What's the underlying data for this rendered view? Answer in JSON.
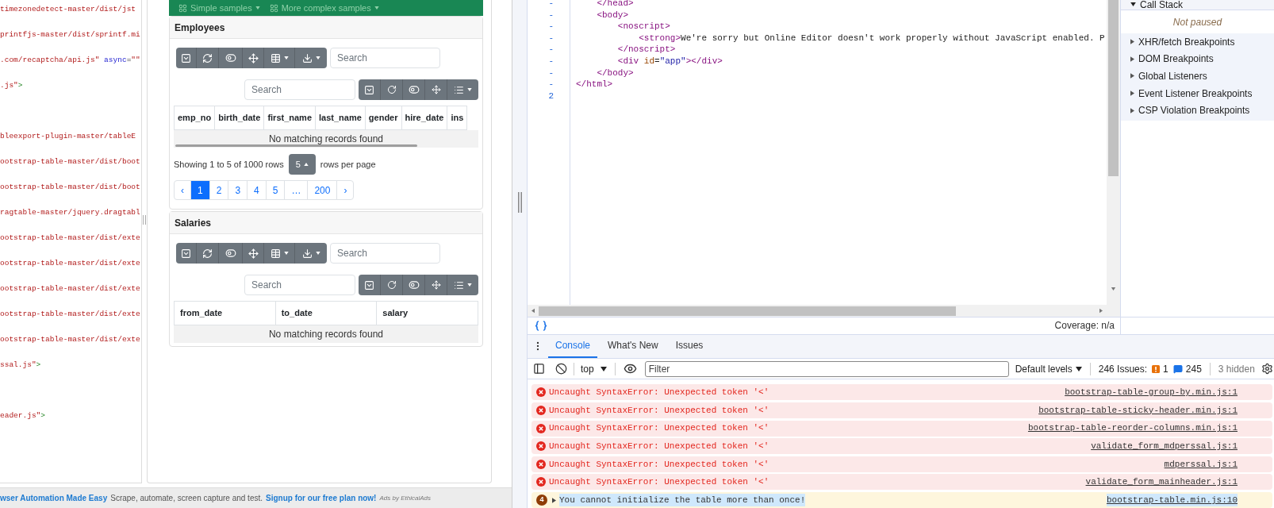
{
  "page": {
    "source_lines": [
      {
        "kind": "code",
        "parts": [
          {
            "kind": "string",
            "text": "timezonedetect-master/dist/jst"
          }
        ]
      },
      {
        "kind": "code",
        "parts": [
          {
            "kind": "string",
            "text": "printfjs-master/dist/sprintf.mi"
          }
        ]
      },
      {
        "kind": "code",
        "parts": [
          {
            "kind": "string",
            "text": ".com/recaptcha/api.js\""
          },
          {
            "kind": "attr",
            "text": " async"
          },
          {
            "kind": "punct",
            "text": "="
          },
          {
            "kind": "string",
            "text": "\"\""
          }
        ]
      },
      {
        "kind": "code",
        "parts": [
          {
            "kind": "string",
            "text": ".js\""
          },
          {
            "kind": "bracket",
            "text": ">"
          }
        ]
      },
      {
        "kind": "blank"
      },
      {
        "kind": "code",
        "parts": [
          {
            "kind": "string",
            "text": "bleexport-plugin-master/tableE"
          }
        ]
      },
      {
        "kind": "code",
        "parts": [
          {
            "kind": "string",
            "text": "ootstrap-table-master/dist/boot"
          }
        ]
      },
      {
        "kind": "code",
        "parts": [
          {
            "kind": "string",
            "text": "ootstrap-table-master/dist/boot"
          }
        ]
      },
      {
        "kind": "code",
        "parts": [
          {
            "kind": "string",
            "text": "ragtable-master/jquery.dragtabl"
          }
        ]
      },
      {
        "kind": "code",
        "parts": [
          {
            "kind": "string",
            "text": "ootstrap-table-master/dist/exte"
          }
        ]
      },
      {
        "kind": "code",
        "parts": [
          {
            "kind": "string",
            "text": "ootstrap-table-master/dist/exte"
          }
        ]
      },
      {
        "kind": "code",
        "parts": [
          {
            "kind": "string",
            "text": "ootstrap-table-master/dist/exte"
          }
        ]
      },
      {
        "kind": "code",
        "parts": [
          {
            "kind": "string",
            "text": "ootstrap-table-master/dist/exte"
          }
        ]
      },
      {
        "kind": "code",
        "parts": [
          {
            "kind": "string",
            "text": "ootstrap-table-master/dist/exte"
          }
        ]
      },
      {
        "kind": "code",
        "parts": [
          {
            "kind": "string",
            "text": "ssal.js\""
          },
          {
            "kind": "bracket",
            "text": ">"
          }
        ]
      },
      {
        "kind": "blank"
      },
      {
        "kind": "code",
        "parts": [
          {
            "kind": "string",
            "text": "eader.js\""
          },
          {
            "kind": "bracket",
            "text": ">"
          }
        ]
      }
    ],
    "samples_bar": {
      "menus": [
        "Simple samples",
        "More complex samples"
      ]
    },
    "tables": [
      {
        "title": "Employees",
        "search_fields": [
          {
            "placeholder": "Search"
          },
          {
            "placeholder": "Search"
          }
        ],
        "columns": [
          "emp_no",
          "birth_date",
          "first_name",
          "last_name",
          "gender",
          "hire_date",
          "ins"
        ],
        "empty_message": "No matching records found",
        "scrollable": true,
        "footer": {
          "showing": "Showing 1 to 5 of 1000 rows",
          "page_size": "5",
          "per_page": "rows per page",
          "pages": [
            {
              "label": "‹",
              "selected": false
            },
            {
              "label": "1",
              "selected": true
            },
            {
              "label": "2",
              "selected": false
            },
            {
              "label": "3",
              "selected": false
            },
            {
              "label": "4",
              "selected": false
            },
            {
              "label": "5",
              "selected": false
            },
            {
              "label": "…",
              "selected": false
            },
            {
              "label": "200",
              "selected": false
            },
            {
              "label": "›",
              "selected": false
            }
          ]
        }
      },
      {
        "title": "Salaries",
        "search_fields": [
          {
            "placeholder": "Search"
          },
          {
            "placeholder": "Search"
          }
        ],
        "columns": [
          "from_date",
          "to_date",
          "salary"
        ],
        "empty_message": "No matching records found",
        "scrollable": false
      }
    ],
    "ad": {
      "headline": "wser Automation Made Easy",
      "body": "Scrape, automate, screen capture and test.",
      "cta": "Signup for our free plan now!",
      "credit": "Ads by EthicalAds"
    }
  },
  "devtools": {
    "editor": {
      "lines": [
        {
          "number": "-",
          "parts": [
            {
              "kind": "tag",
              "text": "    </head>"
            }
          ]
        },
        {
          "number": "-",
          "parts": [
            {
              "kind": "tag",
              "text": "    <body>"
            }
          ]
        },
        {
          "number": "-",
          "parts": [
            {
              "kind": "tag",
              "text": "        <noscript>"
            }
          ]
        },
        {
          "number": "-",
          "parts": [
            {
              "kind": "tag",
              "text": "            <strong>"
            },
            {
              "kind": "text",
              "text": "We're sorry but Online Editor doesn't work properly without JavaScript enabled. P"
            }
          ]
        },
        {
          "number": "-",
          "parts": [
            {
              "kind": "tag",
              "text": "        </noscript>"
            }
          ]
        },
        {
          "number": "-",
          "parts": [
            {
              "kind": "tag",
              "text": "        <div"
            },
            {
              "kind": "attr",
              "text": " id"
            },
            {
              "kind": "punct",
              "text": "="
            },
            {
              "kind": "value",
              "text": "\"app\""
            },
            {
              "kind": "tag",
              "text": "></div>"
            }
          ]
        },
        {
          "number": "-",
          "parts": [
            {
              "kind": "tag",
              "text": "    </body>"
            }
          ]
        },
        {
          "number": "-",
          "parts": [
            {
              "kind": "tag",
              "text": "</html>"
            }
          ]
        },
        {
          "number": "2"
        }
      ],
      "coverage": "Coverage: n/a"
    },
    "sidebar": {
      "call_stack": {
        "title": "Call Stack",
        "expanded": true,
        "status": "Not paused"
      },
      "sections": [
        {
          "title": "XHR/fetch Breakpoints",
          "expanded": false
        },
        {
          "title": "DOM Breakpoints",
          "expanded": false
        },
        {
          "title": "Global Listeners",
          "expanded": false
        },
        {
          "title": "Event Listener Breakpoints",
          "expanded": false
        },
        {
          "title": "CSP Violation Breakpoints",
          "expanded": false
        }
      ]
    },
    "tabs": [
      {
        "label": "Console",
        "selected": true
      },
      {
        "label": "What's New",
        "selected": false
      },
      {
        "label": "Issues",
        "selected": false
      }
    ],
    "console_toolbar": {
      "context": "top",
      "filter_placeholder": "Filter",
      "levels": "Default levels",
      "issues_label": "246 Issues:",
      "warning_count": "1",
      "info_count": "245",
      "hidden": "3 hidden"
    },
    "messages": [
      {
        "kind": "error",
        "expandable": false,
        "highlighted": false,
        "text": "Uncaught SyntaxError: Unexpected token '<'",
        "source": "bootstrap-table-group-by.min.js:1"
      },
      {
        "kind": "error",
        "expandable": false,
        "highlighted": false,
        "text": "Uncaught SyntaxError: Unexpected token '<'",
        "source": "bootstrap-table-sticky-header.min.js:1"
      },
      {
        "kind": "error",
        "expandable": false,
        "highlighted": false,
        "text": "Uncaught SyntaxError: Unexpected token '<'",
        "source": "bootstrap-table-reorder-columns.min.js:1"
      },
      {
        "kind": "error",
        "expandable": false,
        "highlighted": false,
        "text": "Uncaught SyntaxError: Unexpected token '<'",
        "source": "validate_form_mdperssal.js:1"
      },
      {
        "kind": "error",
        "expandable": false,
        "highlighted": false,
        "text": "Uncaught SyntaxError: Unexpected token '<'",
        "source": "mdperssal.js:1"
      },
      {
        "kind": "error",
        "expandable": false,
        "highlighted": false,
        "text": "Uncaught SyntaxError: Unexpected token '<'",
        "source": "validate_form_mainheader.js:1"
      },
      {
        "kind": "warning",
        "count": "4",
        "expandable": true,
        "highlighted": true,
        "text": "You cannot initialize the table more than once!",
        "source": "bootstrap-table.min.js:10"
      }
    ]
  }
}
